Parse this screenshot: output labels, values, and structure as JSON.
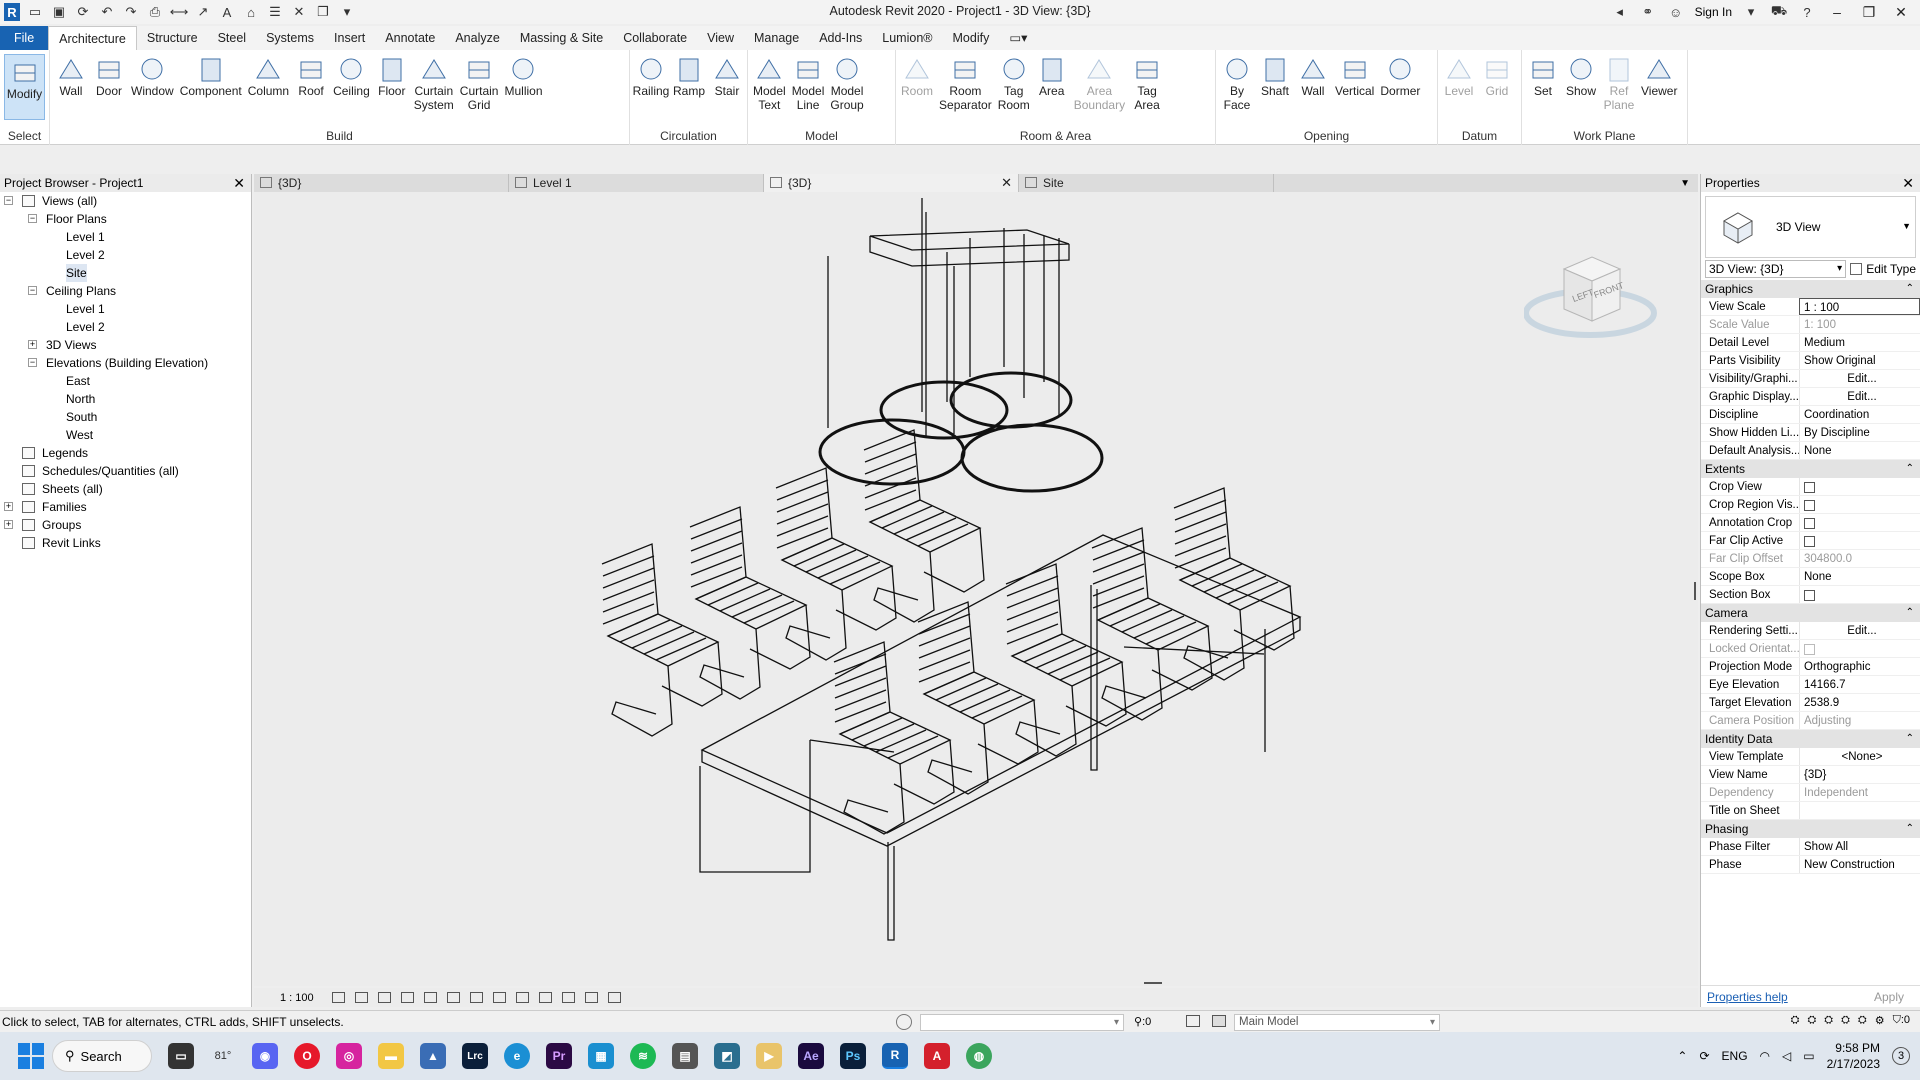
{
  "app": {
    "title": "Autodesk Revit 2020 - Project1 - 3D View: {3D}",
    "sign_in": "Sign In"
  },
  "ribbon_tabs": [
    "File",
    "Architecture",
    "Structure",
    "Steel",
    "Systems",
    "Insert",
    "Annotate",
    "Analyze",
    "Massing & Site",
    "Collaborate",
    "View",
    "Manage",
    "Add-Ins",
    "Lumion®",
    "Modify"
  ],
  "ribbon": {
    "select": {
      "label": "Select",
      "buttons": [
        "Modify"
      ]
    },
    "build": {
      "label": "Build",
      "buttons": [
        "Wall",
        "Door",
        "Window",
        "Component",
        "Column",
        "Roof",
        "Ceiling",
        "Floor",
        "Curtain\nSystem",
        "Curtain\nGrid",
        "Mullion"
      ]
    },
    "circulation": {
      "label": "Circulation",
      "buttons": [
        "Railing",
        "Ramp",
        "Stair"
      ]
    },
    "model": {
      "label": "Model",
      "buttons": [
        "Model\nText",
        "Model\nLine",
        "Model\nGroup"
      ]
    },
    "room_area": {
      "label": "Room & Area",
      "buttons": [
        "Room",
        "Room\nSeparator",
        "Tag\nRoom",
        "Area",
        "Area\nBoundary",
        "Tag\nArea"
      ]
    },
    "opening": {
      "label": "Opening",
      "buttons": [
        "By\nFace",
        "Shaft",
        "Wall",
        "Vertical",
        "Dormer"
      ]
    },
    "datum": {
      "label": "Datum",
      "buttons": [
        "Level",
        "Grid"
      ]
    },
    "work_plane": {
      "label": "Work Plane",
      "buttons": [
        "Set",
        "Show",
        "Ref\nPlane",
        "Viewer"
      ]
    }
  },
  "project_browser": {
    "title": "Project Browser - Project1",
    "items": [
      {
        "label": "Views (all)"
      },
      {
        "label": "Floor Plans"
      },
      {
        "label": "Level 1"
      },
      {
        "label": "Level 2"
      },
      {
        "label": "Site"
      },
      {
        "label": "Ceiling Plans"
      },
      {
        "label": "Level 1"
      },
      {
        "label": "Level 2"
      },
      {
        "label": "3D Views"
      },
      {
        "label": "Elevations (Building Elevation)"
      },
      {
        "label": "East"
      },
      {
        "label": "North"
      },
      {
        "label": "South"
      },
      {
        "label": "West"
      },
      {
        "label": "Legends"
      },
      {
        "label": "Schedules/Quantities (all)"
      },
      {
        "label": "Sheets (all)"
      },
      {
        "label": "Families"
      },
      {
        "label": "Groups"
      },
      {
        "label": "Revit Links"
      }
    ]
  },
  "doc_tabs": [
    "{3D}",
    "Level 1",
    "{3D}",
    "Site"
  ],
  "view_cube": {
    "left": "LEFT",
    "front": "FRONT"
  },
  "view_control": {
    "scale": "1 : 100"
  },
  "properties": {
    "title": "Properties",
    "type_name": "3D View",
    "view_selector": "3D View: {3D}",
    "edit_type": "Edit Type",
    "categories": [
      {
        "name": "Graphics",
        "rows": [
          {
            "n": "View Scale",
            "v": "1 : 100"
          },
          {
            "n": "Scale Value",
            "v": "1:    100"
          },
          {
            "n": "Detail Level",
            "v": "Medium"
          },
          {
            "n": "Parts Visibility",
            "v": "Show Original"
          },
          {
            "n": "Visibility/Graphi...",
            "v": "Edit..."
          },
          {
            "n": "Graphic Display...",
            "v": "Edit..."
          },
          {
            "n": "Discipline",
            "v": "Coordination"
          },
          {
            "n": "Show Hidden Li...",
            "v": "By Discipline"
          },
          {
            "n": "Default Analysis...",
            "v": "None"
          }
        ]
      },
      {
        "name": "Extents",
        "rows": [
          {
            "n": "Crop View",
            "v": ""
          },
          {
            "n": "Crop Region Vis...",
            "v": ""
          },
          {
            "n": "Annotation Crop",
            "v": ""
          },
          {
            "n": "Far Clip Active",
            "v": ""
          },
          {
            "n": "Far Clip Offset",
            "v": "304800.0"
          },
          {
            "n": "Scope Box",
            "v": "None"
          },
          {
            "n": "Section Box",
            "v": ""
          }
        ]
      },
      {
        "name": "Camera",
        "rows": [
          {
            "n": "Rendering Setti...",
            "v": "Edit..."
          },
          {
            "n": "Locked Orientat...",
            "v": ""
          },
          {
            "n": "Projection Mode",
            "v": "Orthographic"
          },
          {
            "n": "Eye Elevation",
            "v": "14166.7"
          },
          {
            "n": "Target Elevation",
            "v": "2538.9"
          },
          {
            "n": "Camera Position",
            "v": "Adjusting"
          }
        ]
      },
      {
        "name": "Identity Data",
        "rows": [
          {
            "n": "View Template",
            "v": "<None>"
          },
          {
            "n": "View Name",
            "v": "{3D}"
          },
          {
            "n": "Dependency",
            "v": "Independent"
          },
          {
            "n": "Title on Sheet",
            "v": ""
          }
        ]
      },
      {
        "name": "Phasing",
        "rows": [
          {
            "n": "Phase Filter",
            "v": "Show All"
          },
          {
            "n": "Phase",
            "v": "New Construction"
          }
        ]
      }
    ],
    "help_link": "Properties help",
    "apply": "Apply"
  },
  "status": {
    "text": "Click to select, TAB for alternates, CTRL adds, SHIFT unselects.",
    "zero1": ":0",
    "model": "Main Model",
    "filter_count": ":0"
  },
  "taskbar": {
    "search": "Search",
    "weather": "81°",
    "lang": "ENG",
    "time": "9:58 PM",
    "date": "2/17/2023",
    "notifications": "3"
  }
}
